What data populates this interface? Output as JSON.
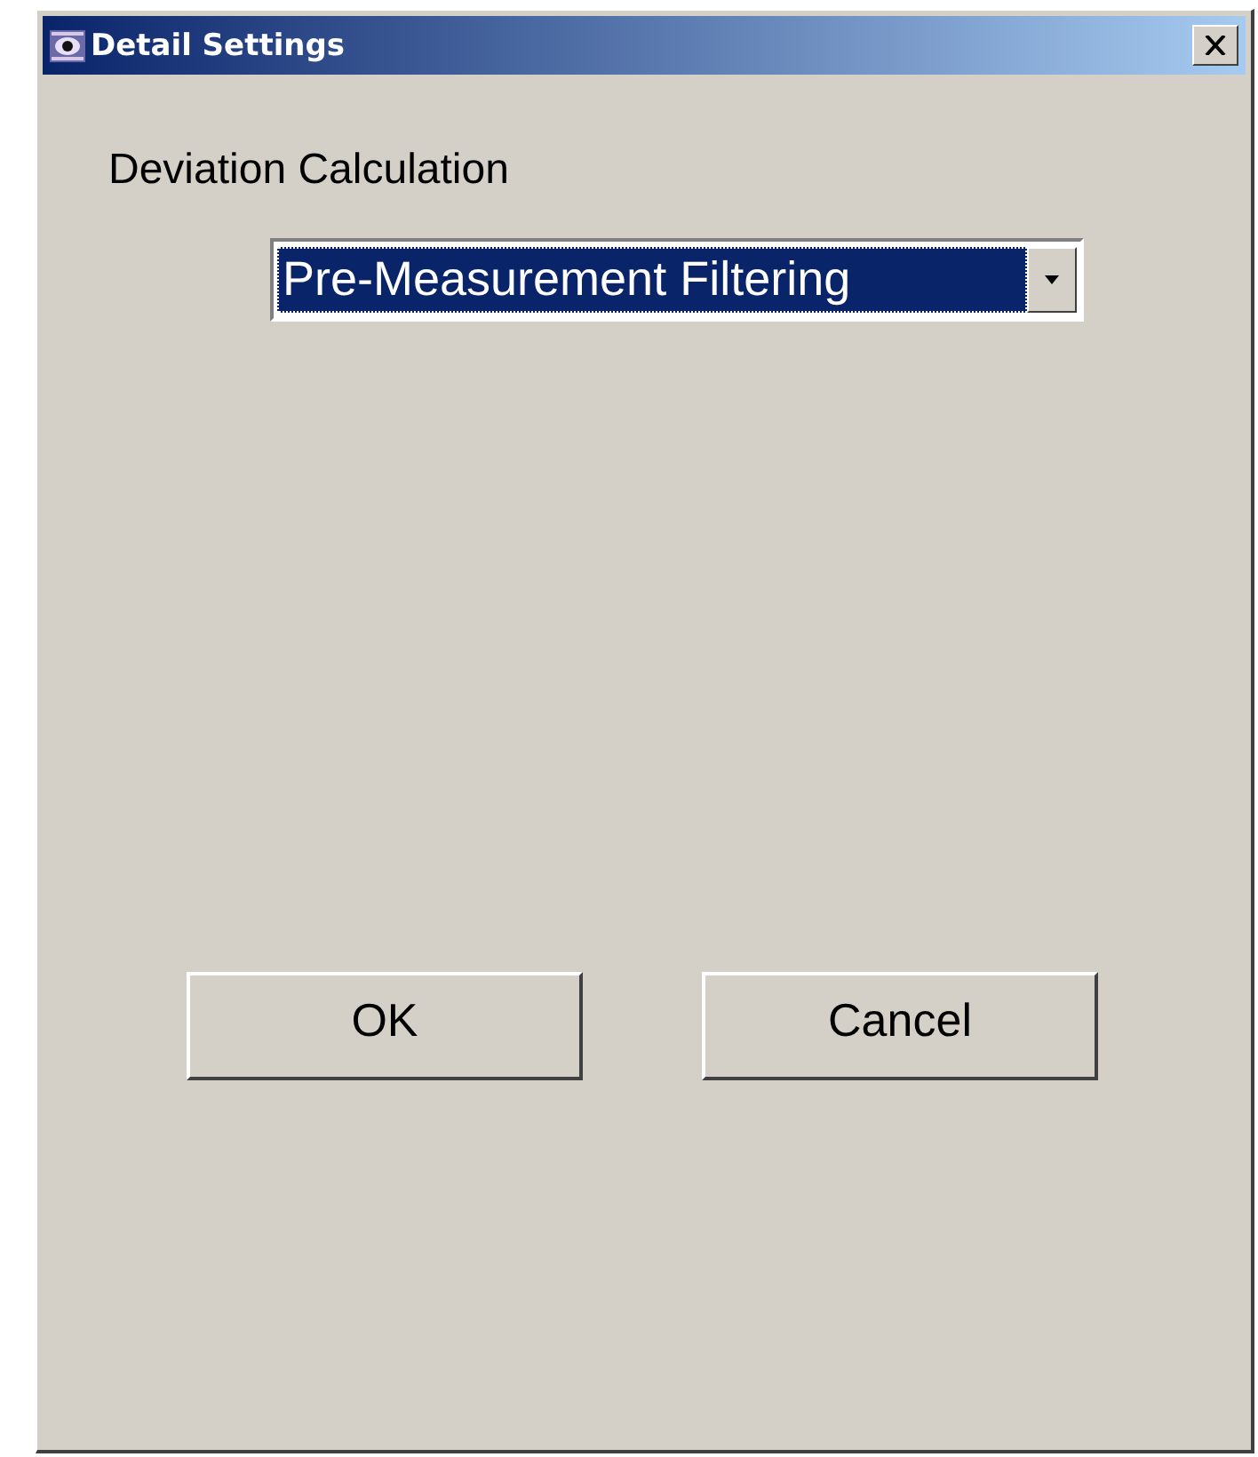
{
  "window": {
    "title": "Detail Settings"
  },
  "field": {
    "label": "Deviation Calculation",
    "value": "Pre-Measurement Filtering",
    "focused": true
  },
  "buttons": [
    "OK",
    "Cancel"
  ]
}
